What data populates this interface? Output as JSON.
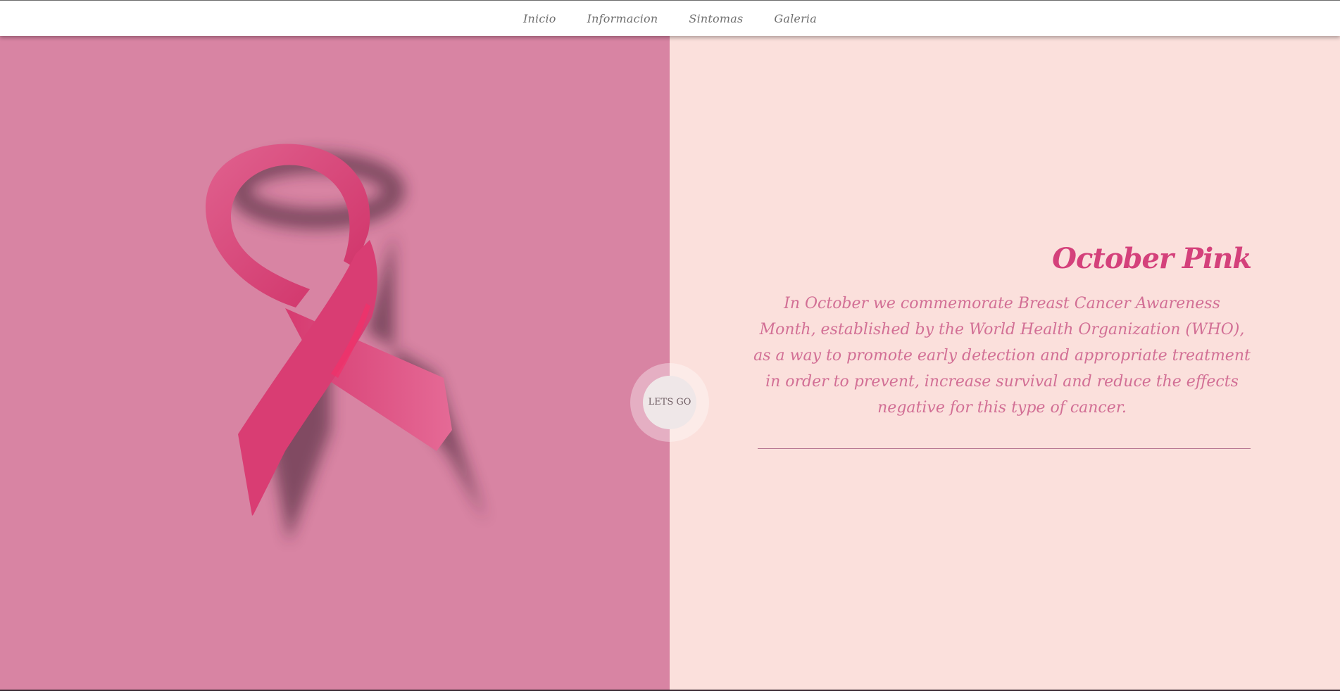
{
  "nav": {
    "items": [
      {
        "label": "Inicio"
      },
      {
        "label": "Informacion"
      },
      {
        "label": "Sintomas"
      },
      {
        "label": "Galeria"
      }
    ]
  },
  "hero": {
    "title": "October Pink",
    "description": "In October we commemorate Breast Cancer Awareness Month, established by the World Health Organization (WHO), as a way to promote early detection and appropriate treatment in order to prevent, increase survival and reduce the effects negative for this type of cancer.",
    "cta_label": "LETS GO"
  },
  "colors": {
    "left_panel": "#d884a3",
    "right_panel": "#fbe0dc",
    "accent": "#d4417b",
    "ribbon": "#de4f83"
  }
}
